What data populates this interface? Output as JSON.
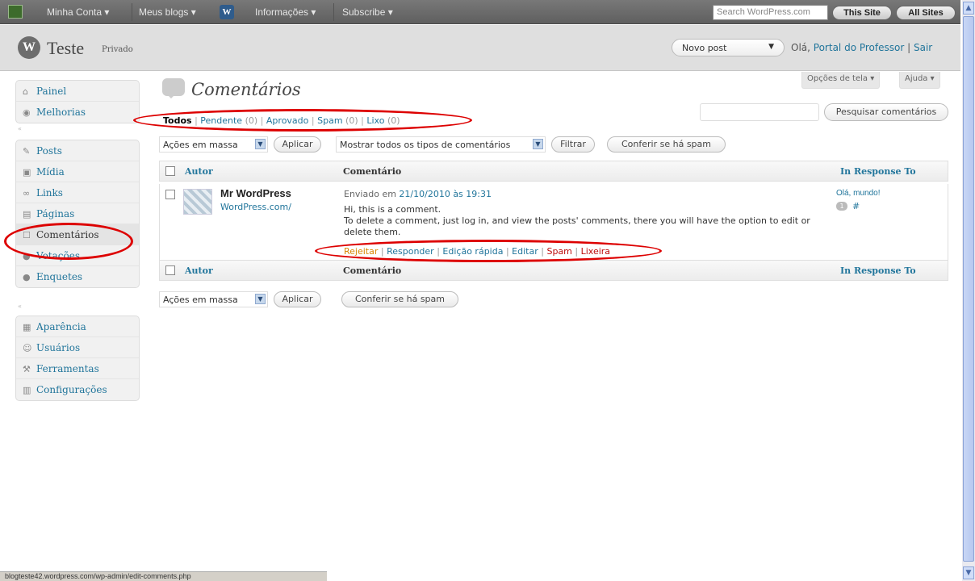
{
  "adminbar": {
    "my_account": "Minha Conta ▾",
    "my_blogs": "Meus blogs ▾",
    "info": "Informações ▾",
    "subscribe": "Subscribe ▾",
    "search_placeholder": "Search WordPress.com",
    "this_site": "This Site",
    "all_sites": "All Sites"
  },
  "header": {
    "logo_glyph": "W",
    "site_name": "Teste",
    "privacy": "Privado",
    "new_post": "Novo post",
    "hello": "Olá,",
    "user": "Portal do Professor",
    "separator": "|",
    "logout": "Sair"
  },
  "screen_options": {
    "screen": "Opções de tela ▾",
    "help": "Ajuda ▾"
  },
  "sidebar": {
    "group1": [
      {
        "icon": "home-icon",
        "label": "Painel"
      },
      {
        "icon": "upgrades-icon",
        "label": "Melhorias"
      }
    ],
    "group2": [
      {
        "icon": "posts-icon",
        "label": "Posts"
      },
      {
        "icon": "media-icon",
        "label": "Mídia"
      },
      {
        "icon": "links-icon",
        "label": "Links"
      },
      {
        "icon": "pages-icon",
        "label": "Páginas"
      },
      {
        "icon": "comments-icon",
        "label": "Comentários",
        "active": true
      },
      {
        "icon": "polls-icon",
        "label": "Votações"
      },
      {
        "icon": "surveys-icon",
        "label": "Enquetes"
      }
    ],
    "group3": [
      {
        "icon": "appearance-icon",
        "label": "Aparência"
      },
      {
        "icon": "users-icon",
        "label": "Usuários"
      },
      {
        "icon": "tools-icon",
        "label": "Ferramentas"
      },
      {
        "icon": "settings-icon",
        "label": "Configurações"
      }
    ]
  },
  "page": {
    "title": "Comentários",
    "filters": {
      "all": "Todos",
      "pending": "Pendente",
      "pending_count": "(0)",
      "approved": "Aprovado",
      "spam": "Spam",
      "spam_count": "(0)",
      "trash": "Lixo",
      "trash_count": "(0)",
      "sep": "|"
    },
    "search_button": "Pesquisar comentários",
    "bulk_actions": "Ações em massa",
    "apply": "Aplicar",
    "comment_type": "Mostrar todos os tipos de comentários",
    "filter": "Filtrar",
    "check_spam": "Conferir se há spam"
  },
  "table": {
    "columns": {
      "author": "Autor",
      "comment": "Comentário",
      "response": "In Response To"
    },
    "rows": [
      {
        "author": "Mr WordPress",
        "author_url": "WordPress.com/",
        "submitted_prefix": "Enviado em",
        "submitted_date": "21/10/2010 às 19:31",
        "text_line1": "Hi, this is a comment.",
        "text_line2": "To delete a comment, just log in, and view the posts' comments, there you will have the option to edit or delete them.",
        "actions": {
          "unapprove": "Rejeitar",
          "reply": "Responder",
          "quick_edit": "Edição rápida",
          "edit": "Editar",
          "spam": "Spam",
          "trash": "Lixeira",
          "sep": "|"
        },
        "response_post": "Olá, mundo!",
        "response_count": "1",
        "response_hash": "#"
      }
    ]
  },
  "statusbar": {
    "url": "blogteste42.wordpress.com/wp-admin/edit-comments.php"
  },
  "colors": {
    "link": "#21759b",
    "annotation": "#dd0000",
    "unapprove": "#d98500",
    "danger": "#bc0b0b"
  }
}
